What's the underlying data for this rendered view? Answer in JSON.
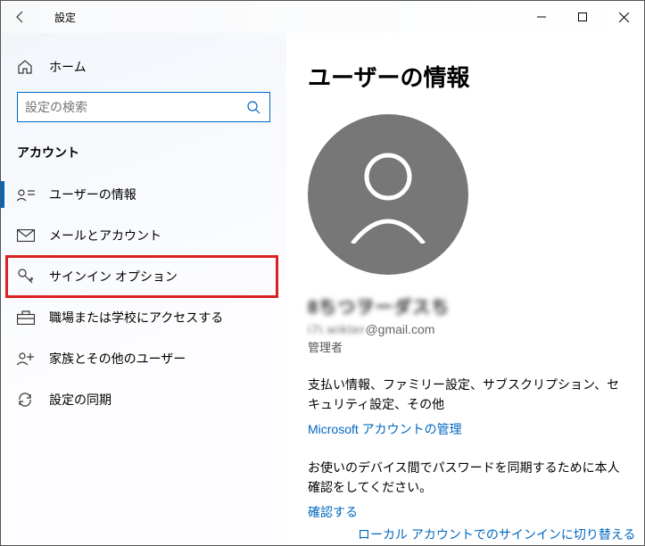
{
  "titlebar": {
    "title": "設定"
  },
  "sidebar": {
    "home": "ホーム",
    "search_placeholder": "設定の検索",
    "section": "アカウント",
    "items": [
      {
        "label": "ユーザーの情報"
      },
      {
        "label": "メールとアカウント"
      },
      {
        "label": "サインイン オプション"
      },
      {
        "label": "職場または学校にアクセスする"
      },
      {
        "label": "家族とその他のユーザー"
      },
      {
        "label": "設定の同期"
      }
    ]
  },
  "main": {
    "heading": "ユーザーの情報",
    "username_masked": "8ちつヲーダスち",
    "email_local_masked": "i7i.wikter",
    "email_domain": "@gmail.com",
    "role": "管理者",
    "payinfo": "支払い情報、ファミリー設定、サブスクリプション、セキュリティ設定、その他",
    "manage_link": "Microsoft アカウントの管理",
    "sync_desc": "お使いのデバイス間でパスワードを同期するために本人確認をしてください。",
    "verify_link": "確認する",
    "local_switch": "ローカル アカウントでのサインインに切り替える"
  }
}
